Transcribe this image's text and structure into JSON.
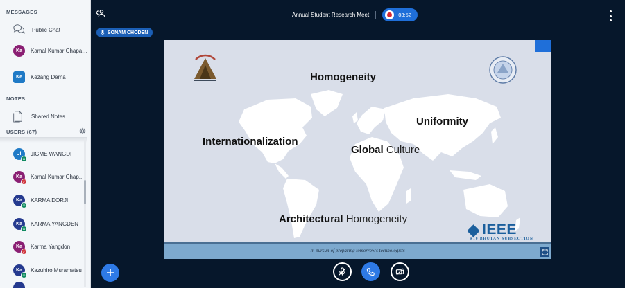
{
  "sidebar": {
    "messages_title": "MESSAGES",
    "public_chat": "Public Chat",
    "chats": [
      {
        "initials": "Ka",
        "name": "Kamal Kumar Chapagai",
        "color": "#8a1f73"
      },
      {
        "initials": "Ke",
        "name": "Kezang Dema",
        "color": "#1f7ac6"
      }
    ],
    "notes_title": "NOTES",
    "shared_notes": "Shared Notes",
    "users_title": "USERS (67)",
    "users": [
      {
        "initials": "Ji",
        "name": "JIGME WANGDI",
        "color": "#1f7ac6",
        "status": "on"
      },
      {
        "initials": "Ka",
        "name": "Kamal Kumar Chap...",
        "color": "#8a1f73",
        "status": "off"
      },
      {
        "initials": "Ka",
        "name": "KARMA DORJI",
        "color": "#253a8f",
        "status": "on"
      },
      {
        "initials": "Ka",
        "name": "KARMA YANGDEN",
        "color": "#253a8f",
        "status": "on"
      },
      {
        "initials": "Ka",
        "name": "Karma Yangdon",
        "color": "#8a1f73",
        "status": "off"
      },
      {
        "initials": "Ka",
        "name": "Kazuhiro Muramatsu",
        "color": "#253a8f",
        "status": "on"
      }
    ]
  },
  "topbar": {
    "title": "Annual Student Research Meet",
    "recording_time": "03:52"
  },
  "presenter": {
    "name": "SONAM CHODEN"
  },
  "slide": {
    "words": {
      "homogeneity": "Homogeneity",
      "uniformity": "Uniformity",
      "internationalization": "Internationalization",
      "global": "Global",
      "culture": "Culture",
      "architectural": "Architectural",
      "homogeneity2": "Homogeneity"
    },
    "ieee": "IEEE",
    "ieee_sub": "R10 BHUTAN SUBSECTION",
    "footer": "In pursuit of preparing tomorrow's technologists"
  },
  "colors": {
    "accent": "#2e7ae6",
    "background": "#06172b",
    "record_red": "#d72833"
  },
  "icons": [
    "chat-bubbles-icon",
    "document-icon",
    "gear-icon",
    "mic-off-icon",
    "phone-icon",
    "camera-off-icon",
    "plus-icon",
    "kebab-icon",
    "user-list-toggle-icon",
    "fullscreen-icon",
    "minimize-icon"
  ]
}
